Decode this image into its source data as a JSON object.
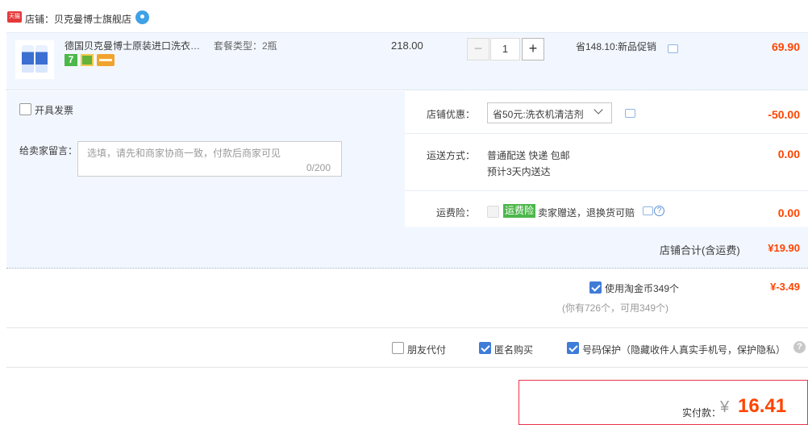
{
  "shop": {
    "badge": "天猫",
    "label": "店铺：贝克曼博士旗舰店"
  },
  "item": {
    "title": "德国贝克曼博士原装进口洗衣机...",
    "sku": "套餐类型：2瓶",
    "tag_seven": "7",
    "unit_price": "218.00",
    "quantity": "1",
    "qty_minus": "−",
    "qty_plus": "+",
    "promo": "省148.10:新品促销",
    "subtotal": "69.90"
  },
  "invoice": {
    "label": "开具发票"
  },
  "message": {
    "label": "给卖家留言：",
    "placeholder": "选填，请先和商家协商一致，付款后商家可见",
    "counter": "0/200"
  },
  "discount": {
    "label": "店铺优惠：",
    "selected": "省50元:洗衣机清洁剂",
    "amount": "-50.00"
  },
  "shipping": {
    "label": "运送方式：",
    "line1": "普通配送 快递 包邮",
    "line2": "预计3天内送达",
    "amount": "0.00"
  },
  "insurance": {
    "label": "运费险：",
    "tag": "运费险",
    "text": "卖家赠送，退换货可赔",
    "help": "?",
    "amount": "0.00"
  },
  "shop_total": {
    "label": "店铺合计(含运费)",
    "amount": "¥19.90"
  },
  "coins": {
    "label": "使用淘金币349个",
    "sub": "(你有726个，可用349个)",
    "amount": "¥-3.49"
  },
  "options": {
    "friend_pay": "朋友代付",
    "anonymous": "匿名购买",
    "privacy": "号码保护（隐藏收件人真实手机号，保护隐私）",
    "help": "?"
  },
  "payment": {
    "label": "实付款：",
    "symbol": "¥",
    "amount": "16.41"
  },
  "colors": {
    "accent_red": "#ff4400",
    "blue": "#3f7cd8",
    "pane_bg": "#f2f7ff"
  },
  "icons": [
    "tmall-icon",
    "wangwang-icon",
    "chat-icon",
    "help-icon",
    "checkbox-icon"
  ]
}
